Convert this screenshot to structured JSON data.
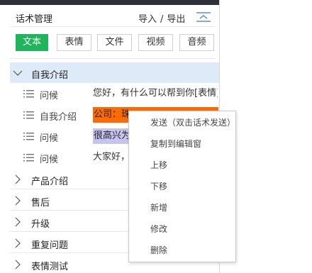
{
  "header": {
    "title": "话术管理",
    "import_label": "导入",
    "separator": "/",
    "export_label": "导出"
  },
  "tabs": [
    {
      "label": "文本",
      "active": true
    },
    {
      "label": "表情",
      "active": false
    },
    {
      "label": "文件",
      "active": false
    },
    {
      "label": "视频",
      "active": false
    },
    {
      "label": "音频",
      "active": false
    }
  ],
  "groups": [
    {
      "label": "自我介绍",
      "expanded": true
    },
    {
      "label": "产品介绍",
      "expanded": false
    },
    {
      "label": "售后",
      "expanded": false
    },
    {
      "label": "升级",
      "expanded": false
    },
    {
      "label": "重复问题",
      "expanded": false
    },
    {
      "label": "表情测试",
      "expanded": false
    }
  ],
  "rows": [
    {
      "name": "问候",
      "content": "您好，有什么可以帮到你[表情]",
      "highlight": ""
    },
    {
      "name": "自我介绍",
      "content": "公司：珠",
      "highlight": "#ff6a00"
    },
    {
      "name": "问候",
      "content": "很高兴为",
      "highlight": "#c5c3ef"
    },
    {
      "name": "问候",
      "content": "大家好，",
      "highlight": ""
    }
  ],
  "context_menu": [
    "发送（双击话术发送）",
    "复制到编辑窗",
    "上移",
    "下移",
    "新增",
    "修改",
    "删除"
  ],
  "colors": {
    "accent_green": "#21b55b",
    "expanded_group_bg": "#ddeaf7",
    "selected_row_bg": "#ff6a00",
    "hover_row_bg": "#c5c3ef"
  }
}
